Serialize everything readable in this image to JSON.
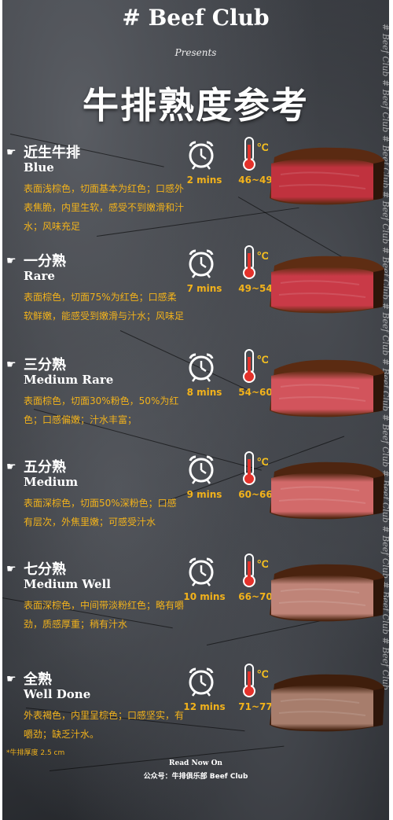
{
  "header": {
    "brand": "# Beef Club",
    "presents": "Presents",
    "title": "牛排熟度参考"
  },
  "watermark": "# Beef Club # Beef Club # Beef Club # Beef Club # Beef Club # Beef Club # Beef Club # Beef Club # Beef Club # Beef Club # Beef Club # Beef Club",
  "levels": [
    {
      "cn": "近生牛排",
      "en": "Blue",
      "desc": "表面浅棕色，切面基本为红色；口感外表焦脆，内里生软，感受不到嫩滑和汁水；风味充足",
      "time": "2 mins",
      "temp": "46~49",
      "meat_color": "#c0323e",
      "crust_color": "#5a2a12"
    },
    {
      "cn": "一分熟",
      "en": "Rare",
      "desc": "表面棕色，切面75%为红色；口感柔软鲜嫩，能感受到嫩滑与汁水；风味足",
      "time": "7 mins",
      "temp": "49~54",
      "meat_color": "#c93a47",
      "crust_color": "#5e2d13"
    },
    {
      "cn": "三分熟",
      "en": "Medium Rare",
      "desc": "表面棕色，切面30%粉色，50%为红色；口感偏嫩；汁水丰富；",
      "time": "8 mins",
      "temp": "54~60",
      "meat_color": "#d2545c",
      "crust_color": "#5b2b12"
    },
    {
      "cn": "五分熟",
      "en": "Medium",
      "desc": "表面深棕色，切面50%深粉色；口感有层次，外焦里嫩；可感受汁水",
      "time": "9 mins",
      "temp": "60~66",
      "meat_color": "#d26a6a",
      "crust_color": "#4e2510"
    },
    {
      "cn": "七分熟",
      "en": "Medium Well",
      "desc": "表面深棕色，中间带淡粉红色；略有嚼劲，质感厚重；稍有汁水",
      "time": "10 mins",
      "temp": "66~70",
      "meat_color": "#bf8478",
      "crust_color": "#4a230f"
    },
    {
      "cn": "全熟",
      "en": "Well Done",
      "desc": "外表褐色，内里呈棕色；口感坚实，有嚼劲；缺乏汁水。",
      "time": "12 mins",
      "temp": "71~77",
      "meat_color": "#a77d6c",
      "crust_color": "#3f1e0c"
    }
  ],
  "thickness_note": "*牛排厚度 2.5 cm",
  "footer": {
    "read_now": "Read Now On",
    "account": "公众号：牛排俱乐部 Beef Club"
  },
  "colors": {
    "accent_text": "#f2b21b",
    "thermo_red": "#e4322b",
    "celsius": "#f5c020"
  },
  "icons": [
    "pointing-hand-icon",
    "alarm-clock-icon",
    "thermometer-icon"
  ]
}
